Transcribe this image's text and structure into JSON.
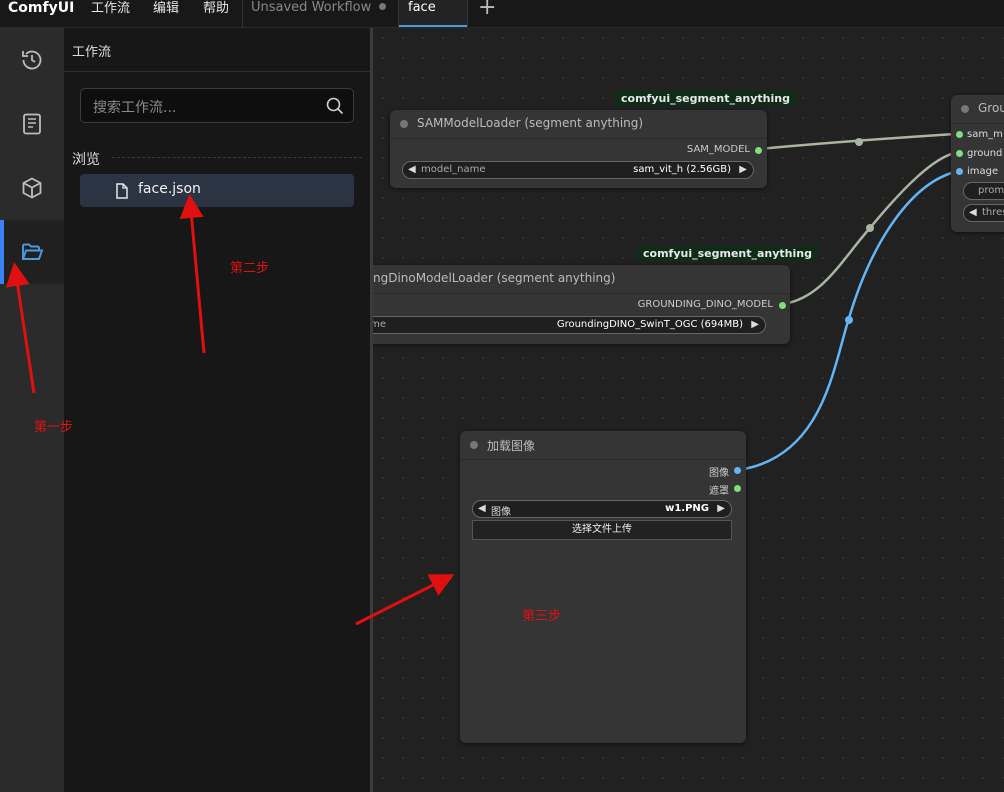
{
  "app": {
    "brand": "ComfyUI"
  },
  "menu": {
    "workflow": "工作流",
    "edit": "编辑",
    "help": "帮助"
  },
  "tabs": [
    {
      "label": "Unsaved Workflow"
    },
    {
      "label": "face"
    }
  ],
  "sidebar": {
    "title": "工作流",
    "search_placeholder": "搜索工作流...",
    "section": "浏览",
    "files": [
      {
        "name": "face.json"
      }
    ],
    "icons": [
      "history-icon",
      "book-icon",
      "cube-icon",
      "folder-open-icon"
    ]
  },
  "nodes": {
    "sam_loader": {
      "badge": "comfyui_segment_anything",
      "title": "SAMModelLoader (segment anything)",
      "output": "SAM_MODEL",
      "widget_label": "model_name",
      "widget_value": "sam_vit_h (2.56GB)"
    },
    "dino_loader": {
      "badge": "comfyui_segment_anything",
      "title": "ngDinoModelLoader (segment anything)",
      "output": "GROUNDING_DINO_MODEL",
      "widget_label": "ame",
      "widget_value": "GroundingDINO_SwinT_OGC (694MB)"
    },
    "load_image": {
      "title": "加载图像",
      "outputs": [
        "图像",
        "遮罩"
      ],
      "widget_label": "图像",
      "widget_value": "w1.PNG",
      "upload_label": "选择文件上传"
    },
    "grounding": {
      "title": "Grou",
      "inputs": [
        "sam_m",
        "ground",
        "image"
      ],
      "widgets": [
        "prom",
        "thres"
      ]
    }
  },
  "annotations": {
    "step1": "第一步",
    "step2": "第二步",
    "step3": "第三步"
  },
  "colors": {
    "accent": "#3b82f6",
    "annotation": "#e01010",
    "model_wire": "#a8b5a0",
    "image_wire": "#64b5f6"
  }
}
